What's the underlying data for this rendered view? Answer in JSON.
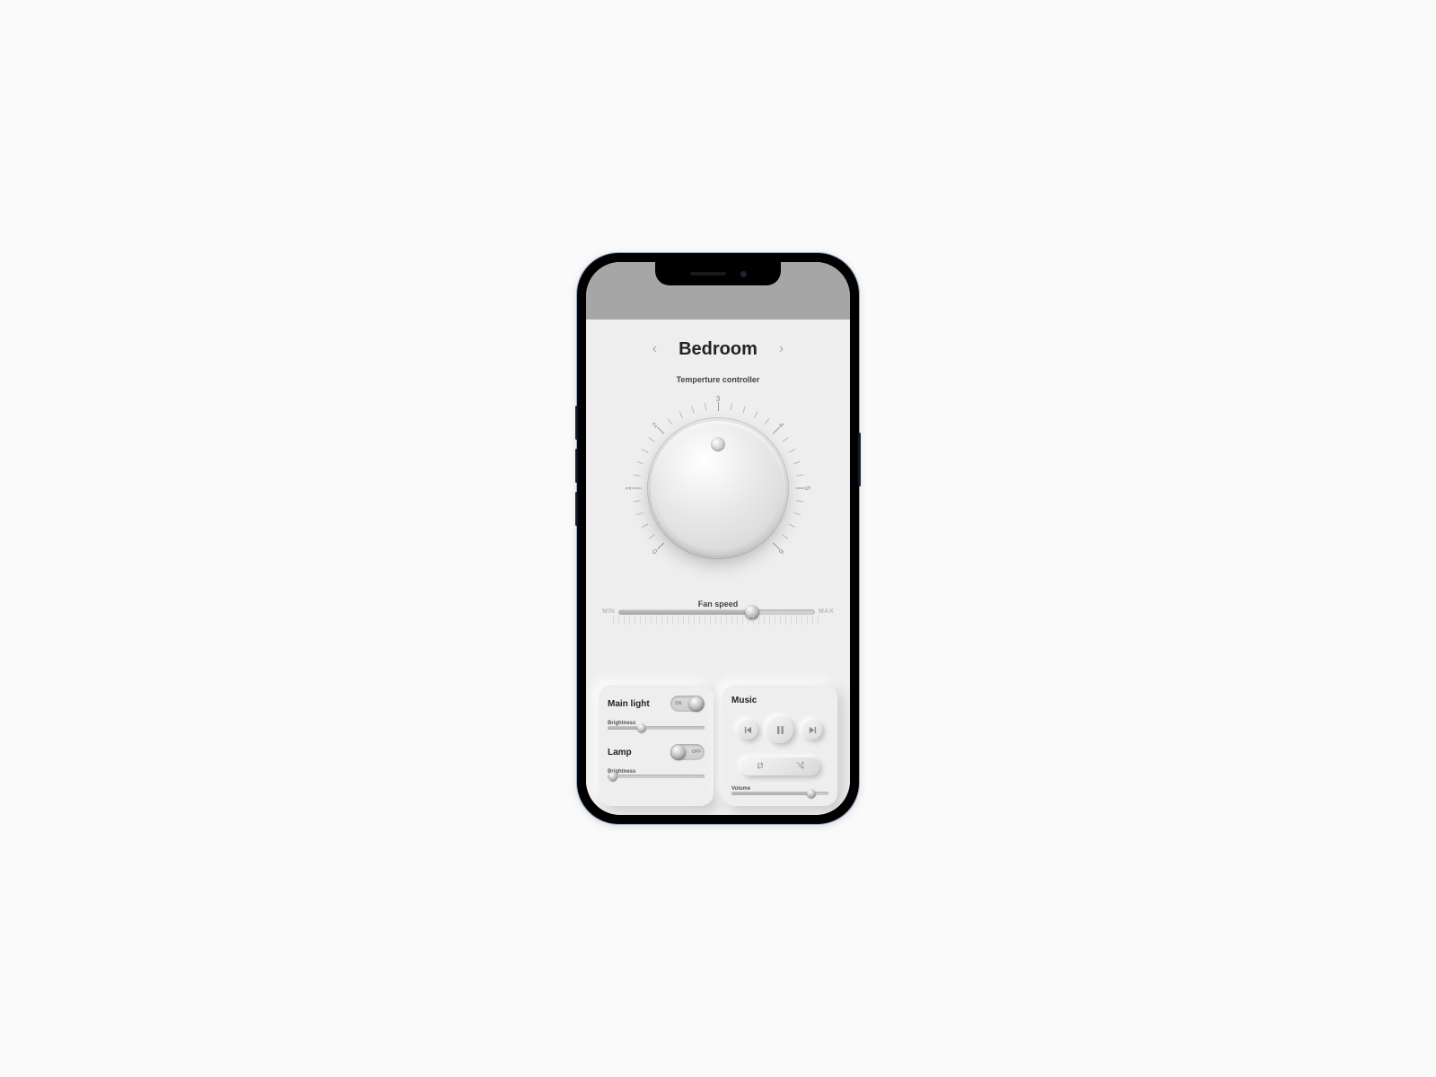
{
  "header": {
    "room": "Bedroom"
  },
  "temperature": {
    "label": "Temperture controller",
    "scale": [
      "0",
      "1",
      "2",
      "3",
      "4",
      "5",
      "6"
    ],
    "pointer_at": 3
  },
  "fan": {
    "label": "Fan speed",
    "min_label": "MIN",
    "max_label": "MAX",
    "value_pct": 68
  },
  "lights": {
    "main": {
      "title": "Main light",
      "on": true,
      "on_label": "ON",
      "off_label": "OFF",
      "brightness_label": "Brightness",
      "brightness_pct": 35
    },
    "lamp": {
      "title": "Lamp",
      "on": false,
      "on_label": "ON",
      "off_label": "OFF",
      "brightness_label": "Brightness",
      "brightness_pct": 6
    }
  },
  "music": {
    "title": "Music",
    "volume_label": "Volume",
    "volume_pct": 82
  }
}
